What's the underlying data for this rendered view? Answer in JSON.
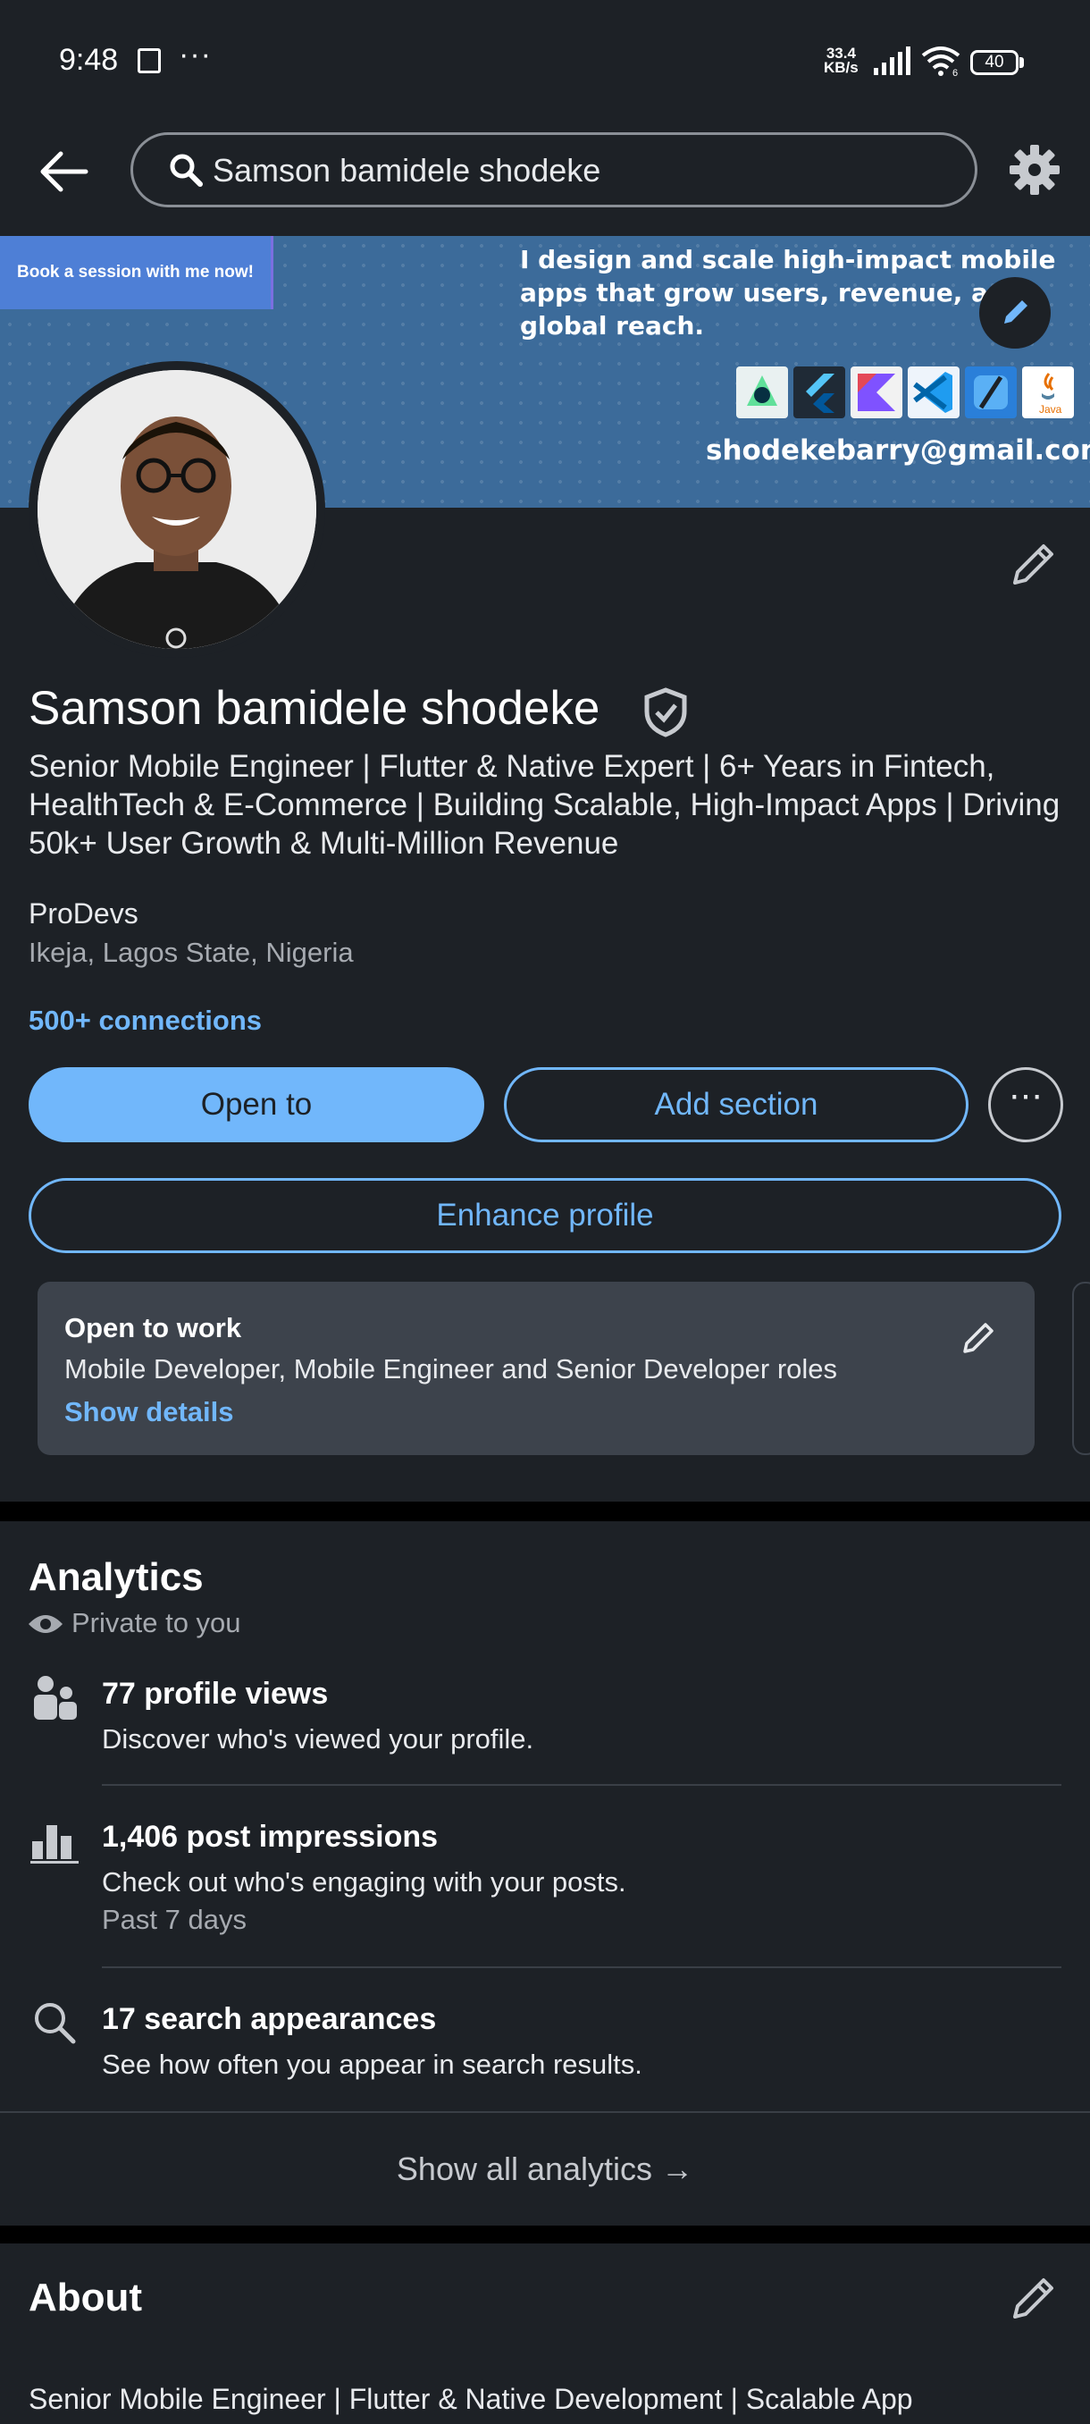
{
  "status_bar": {
    "time": "9:48",
    "net_speed_value": "33.4",
    "net_speed_unit": "KB/s",
    "wifi_label": "6",
    "battery": "40"
  },
  "search": {
    "value": "Samson bamidele shodeke"
  },
  "banner": {
    "book_button": "Book a session with me now!",
    "tagline": "I design and scale high-impact mobile apps that grow users, revenue, and global reach.",
    "email": "shodekebarry@gmail.com",
    "logos": [
      "android-studio-logo",
      "flutter-logo",
      "kotlin-logo",
      "vscode-logo",
      "xcode-logo",
      "java-logo"
    ],
    "java_label": "Java"
  },
  "profile": {
    "name": "Samson bamidele shodeke",
    "headline": "Senior Mobile Engineer | Flutter & Native Expert | 6+ Years in Fintech, HealthTech & E-Commerce | Building Scalable, High-Impact Apps | Driving 50k+ User Growth & Multi-Million Revenue",
    "company": "ProDevs",
    "location": "Ikeja, Lagos State, Nigeria",
    "connections": "500+ connections"
  },
  "actions": {
    "open_to": "Open to",
    "add_section": "Add section",
    "more": "⋯",
    "enhance": "Enhance profile"
  },
  "open_to_work": {
    "title": "Open to work",
    "description": "Mobile Developer, Mobile Engineer and Senior Developer roles",
    "link": "Show details"
  },
  "analytics": {
    "title": "Analytics",
    "privacy": "Private to you",
    "items": [
      {
        "icon": "people-icon",
        "heading": "77 profile views",
        "sub": "Discover who's viewed your profile.",
        "extra": ""
      },
      {
        "icon": "bar-chart-icon",
        "heading": "1,406 post impressions",
        "sub": "Check out who's engaging with your posts.",
        "extra": "Past 7 days"
      },
      {
        "icon": "search-icon",
        "heading": "17 search appearances",
        "sub": "See how often you appear in search results.",
        "extra": ""
      }
    ],
    "show_all": "Show all analytics →"
  },
  "about": {
    "title": "About",
    "text": "Senior Mobile Engineer | Flutter & Native Development | Scalable App"
  },
  "colors": {
    "accent": "#71b7fb",
    "background": "#1d2126",
    "card": "#3d434c"
  }
}
